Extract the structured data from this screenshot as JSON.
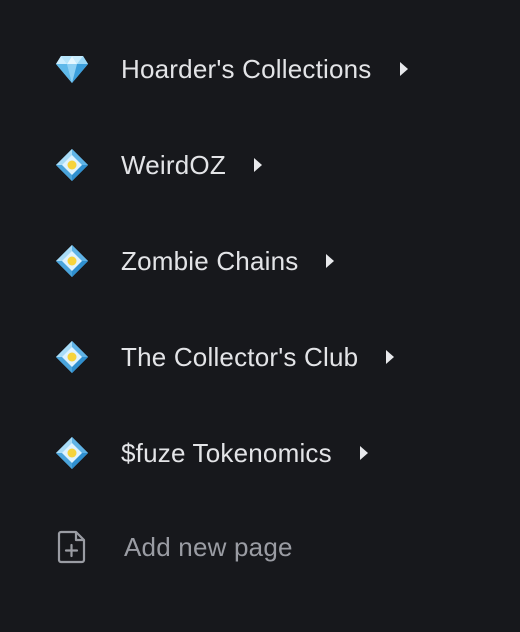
{
  "sidebar": {
    "items": [
      {
        "label": "Hoarder's Collections",
        "icon": "gem-icon"
      },
      {
        "label": "WeirdOZ",
        "icon": "diamond-with-dot-icon"
      },
      {
        "label": "Zombie Chains",
        "icon": "diamond-with-dot-icon"
      },
      {
        "label": "The Collector's Club",
        "icon": "diamond-with-dot-icon"
      },
      {
        "label": "$fuze Tokenomics",
        "icon": "diamond-with-dot-icon"
      }
    ],
    "add_page": {
      "label": "Add new page",
      "icon": "file-plus-icon"
    }
  },
  "colors": {
    "background": "#17181c",
    "text": "#e3e4e7",
    "muted_text": "#9a9ca3",
    "gem_light": "#bfe9ff",
    "gem_dark": "#3fa6e4",
    "dot_yellow": "#f6d33c"
  }
}
